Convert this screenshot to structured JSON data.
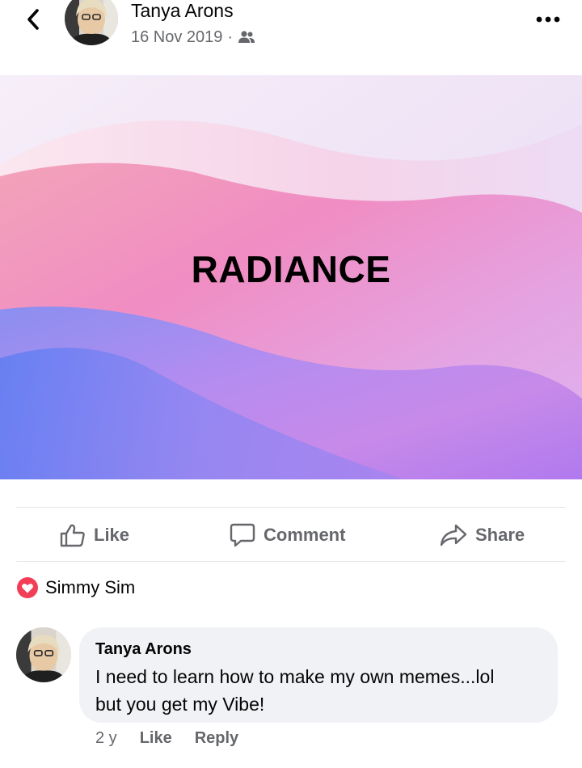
{
  "header": {
    "author_name": "Tanya Arons",
    "date": "16 Nov 2019",
    "separator": "·",
    "audience_icon": "friends-icon",
    "back_icon": "chevron-left-icon",
    "more_icon": "more-dots-icon"
  },
  "post": {
    "image_text": "RADIANCE"
  },
  "actions": {
    "like": "Like",
    "comment": "Comment",
    "share": "Share"
  },
  "reactions": {
    "icon": "love-reaction-icon",
    "name": "Simmy Sim"
  },
  "comment": {
    "author": "Tanya Arons",
    "text_line1": "I need to learn how to make my own memes...lol",
    "text_line2": "but you get my Vibe!",
    "time": "2 y",
    "like_label": "Like",
    "reply_label": "Reply"
  },
  "colors": {
    "meta_gray": "#65676b",
    "bubble_bg": "#f0f2f5",
    "love_red": "#f33e58"
  }
}
